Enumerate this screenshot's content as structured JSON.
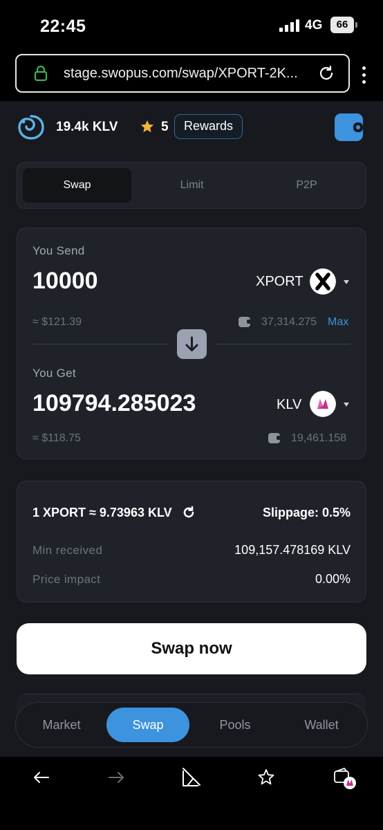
{
  "status_bar": {
    "time": "22:45",
    "network": "4G",
    "battery": "66"
  },
  "browser": {
    "url": "stage.swopus.com/swap/XPORT-2K..."
  },
  "header": {
    "balance": "19.4k KLV",
    "stars": "5",
    "rewards_label": "Rewards"
  },
  "tabs": [
    {
      "label": "Swap",
      "active": true
    },
    {
      "label": "Limit",
      "active": false
    },
    {
      "label": "P2P",
      "active": false
    }
  ],
  "send": {
    "label": "You Send",
    "amount": "10000",
    "token": "XPORT",
    "usd": "≈ $121.39",
    "balance": "37,314.275",
    "max_label": "Max"
  },
  "get": {
    "label": "You Get",
    "amount": "109794.285023",
    "token": "KLV",
    "usd": "≈ $118.75",
    "balance": "19,461.158"
  },
  "info": {
    "rate": "1 XPORT ≈ 9.73963 KLV",
    "slippage": "Slippage: 0.5%",
    "min_received_label": "Min received",
    "min_received_value": "109,157.478169 KLV",
    "price_impact_label": "Price impact",
    "price_impact_value": "0.00%"
  },
  "swap_button": "Swap now",
  "bottom_nav": [
    {
      "label": "Market",
      "active": false
    },
    {
      "label": "Swap",
      "active": true
    },
    {
      "label": "Pools",
      "active": false
    },
    {
      "label": "Wallet",
      "active": false
    }
  ],
  "colors": {
    "accent": "#3d93dd",
    "background": "#17191e",
    "card": "#1f2229",
    "star": "#f2b53a",
    "klv_pink": "#c0308a"
  }
}
